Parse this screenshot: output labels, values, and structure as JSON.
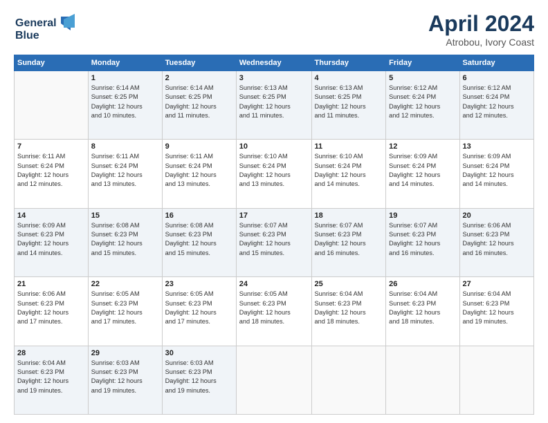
{
  "header": {
    "logo_line1": "General",
    "logo_line2": "Blue",
    "month": "April 2024",
    "location": "Atrobou, Ivory Coast"
  },
  "days_of_week": [
    "Sunday",
    "Monday",
    "Tuesday",
    "Wednesday",
    "Thursday",
    "Friday",
    "Saturday"
  ],
  "weeks": [
    [
      {
        "num": "",
        "info": ""
      },
      {
        "num": "1",
        "info": "Sunrise: 6:14 AM\nSunset: 6:25 PM\nDaylight: 12 hours\nand 10 minutes."
      },
      {
        "num": "2",
        "info": "Sunrise: 6:14 AM\nSunset: 6:25 PM\nDaylight: 12 hours\nand 11 minutes."
      },
      {
        "num": "3",
        "info": "Sunrise: 6:13 AM\nSunset: 6:25 PM\nDaylight: 12 hours\nand 11 minutes."
      },
      {
        "num": "4",
        "info": "Sunrise: 6:13 AM\nSunset: 6:25 PM\nDaylight: 12 hours\nand 11 minutes."
      },
      {
        "num": "5",
        "info": "Sunrise: 6:12 AM\nSunset: 6:24 PM\nDaylight: 12 hours\nand 12 minutes."
      },
      {
        "num": "6",
        "info": "Sunrise: 6:12 AM\nSunset: 6:24 PM\nDaylight: 12 hours\nand 12 minutes."
      }
    ],
    [
      {
        "num": "7",
        "info": "Sunrise: 6:11 AM\nSunset: 6:24 PM\nDaylight: 12 hours\nand 12 minutes."
      },
      {
        "num": "8",
        "info": "Sunrise: 6:11 AM\nSunset: 6:24 PM\nDaylight: 12 hours\nand 13 minutes."
      },
      {
        "num": "9",
        "info": "Sunrise: 6:11 AM\nSunset: 6:24 PM\nDaylight: 12 hours\nand 13 minutes."
      },
      {
        "num": "10",
        "info": "Sunrise: 6:10 AM\nSunset: 6:24 PM\nDaylight: 12 hours\nand 13 minutes."
      },
      {
        "num": "11",
        "info": "Sunrise: 6:10 AM\nSunset: 6:24 PM\nDaylight: 12 hours\nand 14 minutes."
      },
      {
        "num": "12",
        "info": "Sunrise: 6:09 AM\nSunset: 6:24 PM\nDaylight: 12 hours\nand 14 minutes."
      },
      {
        "num": "13",
        "info": "Sunrise: 6:09 AM\nSunset: 6:24 PM\nDaylight: 12 hours\nand 14 minutes."
      }
    ],
    [
      {
        "num": "14",
        "info": "Sunrise: 6:09 AM\nSunset: 6:23 PM\nDaylight: 12 hours\nand 14 minutes."
      },
      {
        "num": "15",
        "info": "Sunrise: 6:08 AM\nSunset: 6:23 PM\nDaylight: 12 hours\nand 15 minutes."
      },
      {
        "num": "16",
        "info": "Sunrise: 6:08 AM\nSunset: 6:23 PM\nDaylight: 12 hours\nand 15 minutes."
      },
      {
        "num": "17",
        "info": "Sunrise: 6:07 AM\nSunset: 6:23 PM\nDaylight: 12 hours\nand 15 minutes."
      },
      {
        "num": "18",
        "info": "Sunrise: 6:07 AM\nSunset: 6:23 PM\nDaylight: 12 hours\nand 16 minutes."
      },
      {
        "num": "19",
        "info": "Sunrise: 6:07 AM\nSunset: 6:23 PM\nDaylight: 12 hours\nand 16 minutes."
      },
      {
        "num": "20",
        "info": "Sunrise: 6:06 AM\nSunset: 6:23 PM\nDaylight: 12 hours\nand 16 minutes."
      }
    ],
    [
      {
        "num": "21",
        "info": "Sunrise: 6:06 AM\nSunset: 6:23 PM\nDaylight: 12 hours\nand 17 minutes."
      },
      {
        "num": "22",
        "info": "Sunrise: 6:05 AM\nSunset: 6:23 PM\nDaylight: 12 hours\nand 17 minutes."
      },
      {
        "num": "23",
        "info": "Sunrise: 6:05 AM\nSunset: 6:23 PM\nDaylight: 12 hours\nand 17 minutes."
      },
      {
        "num": "24",
        "info": "Sunrise: 6:05 AM\nSunset: 6:23 PM\nDaylight: 12 hours\nand 18 minutes."
      },
      {
        "num": "25",
        "info": "Sunrise: 6:04 AM\nSunset: 6:23 PM\nDaylight: 12 hours\nand 18 minutes."
      },
      {
        "num": "26",
        "info": "Sunrise: 6:04 AM\nSunset: 6:23 PM\nDaylight: 12 hours\nand 18 minutes."
      },
      {
        "num": "27",
        "info": "Sunrise: 6:04 AM\nSunset: 6:23 PM\nDaylight: 12 hours\nand 19 minutes."
      }
    ],
    [
      {
        "num": "28",
        "info": "Sunrise: 6:04 AM\nSunset: 6:23 PM\nDaylight: 12 hours\nand 19 minutes."
      },
      {
        "num": "29",
        "info": "Sunrise: 6:03 AM\nSunset: 6:23 PM\nDaylight: 12 hours\nand 19 minutes."
      },
      {
        "num": "30",
        "info": "Sunrise: 6:03 AM\nSunset: 6:23 PM\nDaylight: 12 hours\nand 19 minutes."
      },
      {
        "num": "",
        "info": ""
      },
      {
        "num": "",
        "info": ""
      },
      {
        "num": "",
        "info": ""
      },
      {
        "num": "",
        "info": ""
      }
    ]
  ]
}
